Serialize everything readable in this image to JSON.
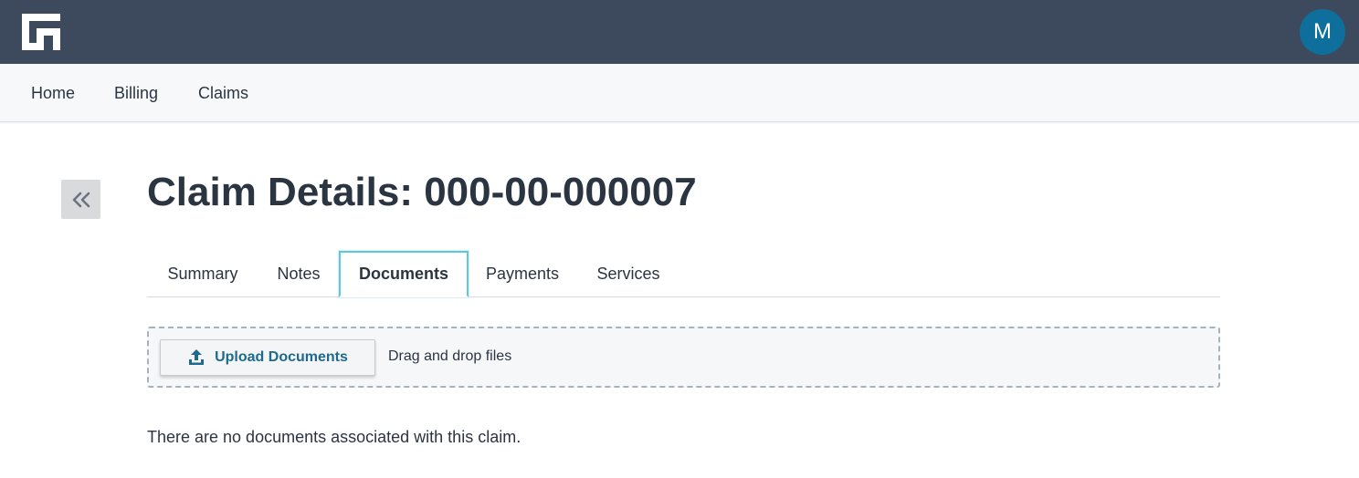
{
  "header": {
    "logo_icon": "brand-logo-icon",
    "avatar_initial": "M",
    "avatar_color": "#0e6e9c",
    "bar_color": "#3d4a5e"
  },
  "nav": {
    "items": [
      {
        "label": "Home"
      },
      {
        "label": "Billing"
      },
      {
        "label": "Claims"
      }
    ]
  },
  "sidebar": {
    "collapse_icon": "double-chevron-left-icon"
  },
  "page": {
    "title": "Claim Details: 000-00-000007"
  },
  "tabs": {
    "items": [
      {
        "label": "Summary"
      },
      {
        "label": "Notes"
      },
      {
        "label": "Documents"
      },
      {
        "label": "Payments"
      },
      {
        "label": "Services"
      }
    ],
    "active": "Documents",
    "active_border_color": "#5ec8dc"
  },
  "documents": {
    "upload_label": "Upload Documents",
    "upload_icon": "upload-icon",
    "drop_hint": "Drag and drop files",
    "empty_message": "There are no documents associated with this claim."
  }
}
